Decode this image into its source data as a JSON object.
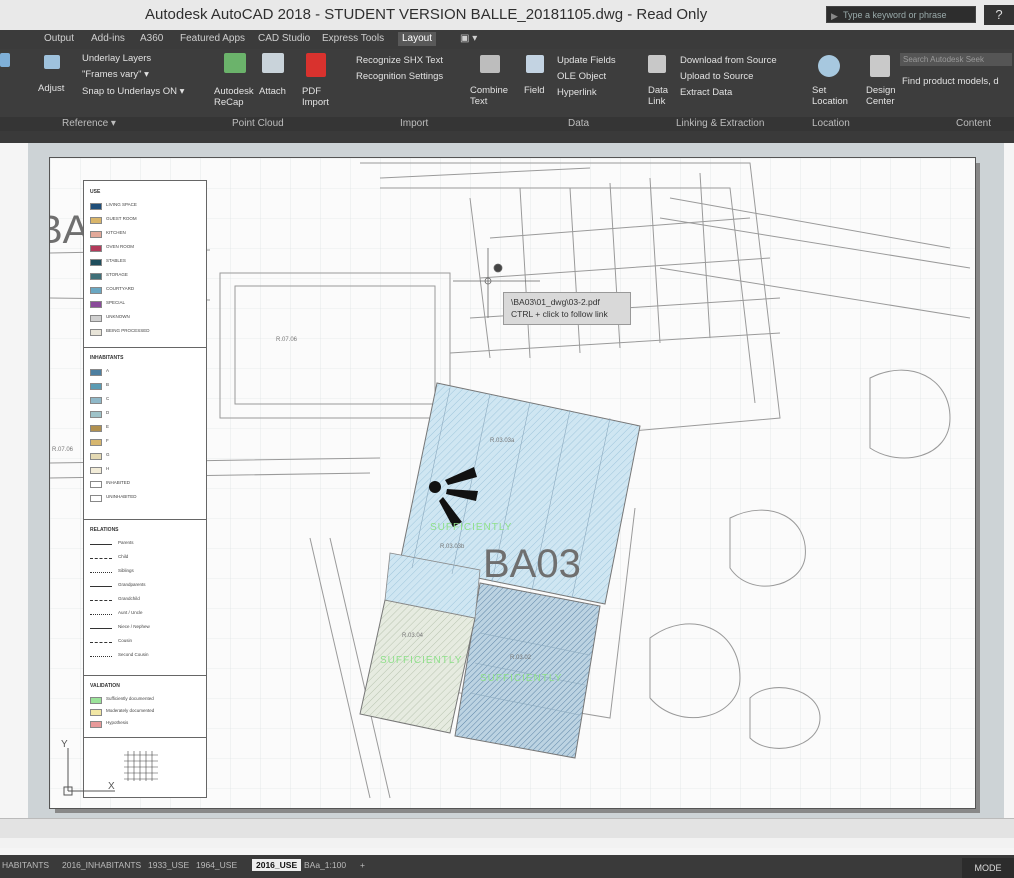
{
  "window": {
    "title": "Autodesk AutoCAD 2018 - STUDENT VERSION    BALLE_20181105.dwg - Read Only",
    "search_placeholder": "Type a keyword or phrase",
    "help_glyph": "?"
  },
  "ribbon_tabs": [
    "Output",
    "Add-ins",
    "A360",
    "Featured Apps",
    "CAD Studio",
    "Express Tools",
    "Layout",
    "▣ ▾"
  ],
  "ribbon_active_tab": "Layout",
  "ribbon": {
    "reference": {
      "items": [
        "Underlay Layers",
        "\"Frames vary\" ▾",
        "Snap to Underlays ON ▾"
      ],
      "adjust": "Adjust",
      "title": "Reference ▾"
    },
    "point_cloud": {
      "items": [
        "Autodesk ReCap",
        "Attach"
      ],
      "title": "Point Cloud"
    },
    "import": {
      "pdf_import": "PDF Import",
      "items": [
        "Recognize SHX Text",
        "Recognition Settings"
      ],
      "combine": "Combine Text",
      "title": "Import"
    },
    "data": {
      "field": "Field",
      "items": [
        "Update Fields",
        "OLE Object",
        "Hyperlink"
      ],
      "title": "Data"
    },
    "linking": {
      "data_link": "Data Link",
      "items": [
        "Download from Source",
        "Upload to Source",
        "Extract  Data"
      ],
      "title": "Linking & Extraction"
    },
    "location": {
      "set_location": "Set Location",
      "title": "Location"
    },
    "content": {
      "design_center": "Design Center",
      "search": "Search Autodesk Seek",
      "find": "Find product models, d",
      "title": "Content"
    }
  },
  "legend": {
    "use_title": "USE",
    "use_items": [
      "LIVING SPACE",
      "GUEST ROOM",
      "KITCHEN",
      "OVEN ROOM",
      "STABLES",
      "STORAGE",
      "COURTYARD",
      "SPECIAL",
      "UNKNOWN",
      "BEING PROCESSED"
    ],
    "use_colors": [
      "#1f4e79",
      "#d9b56a",
      "#e3a99a",
      "#b23a5a",
      "#1e4d5c",
      "#3f6f78",
      "#6aa7c2",
      "#8a4b9a",
      "#d0d0d0",
      "#e8e4d8"
    ],
    "inhab_title": "INHABITANTS",
    "inhab_items": [
      "A",
      "B",
      "C",
      "D",
      "E",
      "F",
      "G",
      "H",
      "INHABITED",
      "UNINHABITED"
    ],
    "inhab_colors": [
      "#4d7fa0",
      "#5a9bb3",
      "#8fb8c8",
      "#9fc3c9",
      "#b0904f",
      "#d6b66e",
      "#e4d9b3",
      "#f2ecd8",
      "#ffffff",
      "#ffffff"
    ],
    "rel_title": "RELATIONS",
    "rel_items": [
      "Parents",
      "Child",
      "Siblings",
      "Grandparents",
      "Grandchild",
      "Aunt / Uncle",
      "Niece / Nephew",
      "Cousin",
      "Second Cousin"
    ],
    "val_title": "VALIDATION",
    "val_items": [
      "Sufficiently documented",
      "Moderately documented",
      "Hypothesis"
    ],
    "val_colors": [
      "#9be39a",
      "#f2e7a5",
      "#e89a9a"
    ]
  },
  "drawing": {
    "tooltip_line1": "\\BA03\\01_dwg\\03-2.pdf",
    "tooltip_line2": "CTRL + click to follow link",
    "main_label": "BA03",
    "left_label": "BA",
    "rooms": [
      "R.07.06",
      "R.03.03a",
      "R.03.03b",
      "R.03.04",
      "R.03.02",
      "R.07.06"
    ],
    "green_labels": [
      "SUFFICIENTLY",
      "SUFFICIENTLY",
      "SUFFICIENTLY"
    ]
  },
  "layout_tabs": [
    "HABITANTS",
    "2016_INHABITANTS",
    "1933_USE",
    "1964_USE",
    "2016_USE",
    "BAa_1:100",
    "+"
  ],
  "layout_active": "2016_USE",
  "status": {
    "model": "MODE"
  },
  "colors": {
    "accent": "#9fd3ea",
    "ribbon_bg": "#3d3d3d"
  }
}
